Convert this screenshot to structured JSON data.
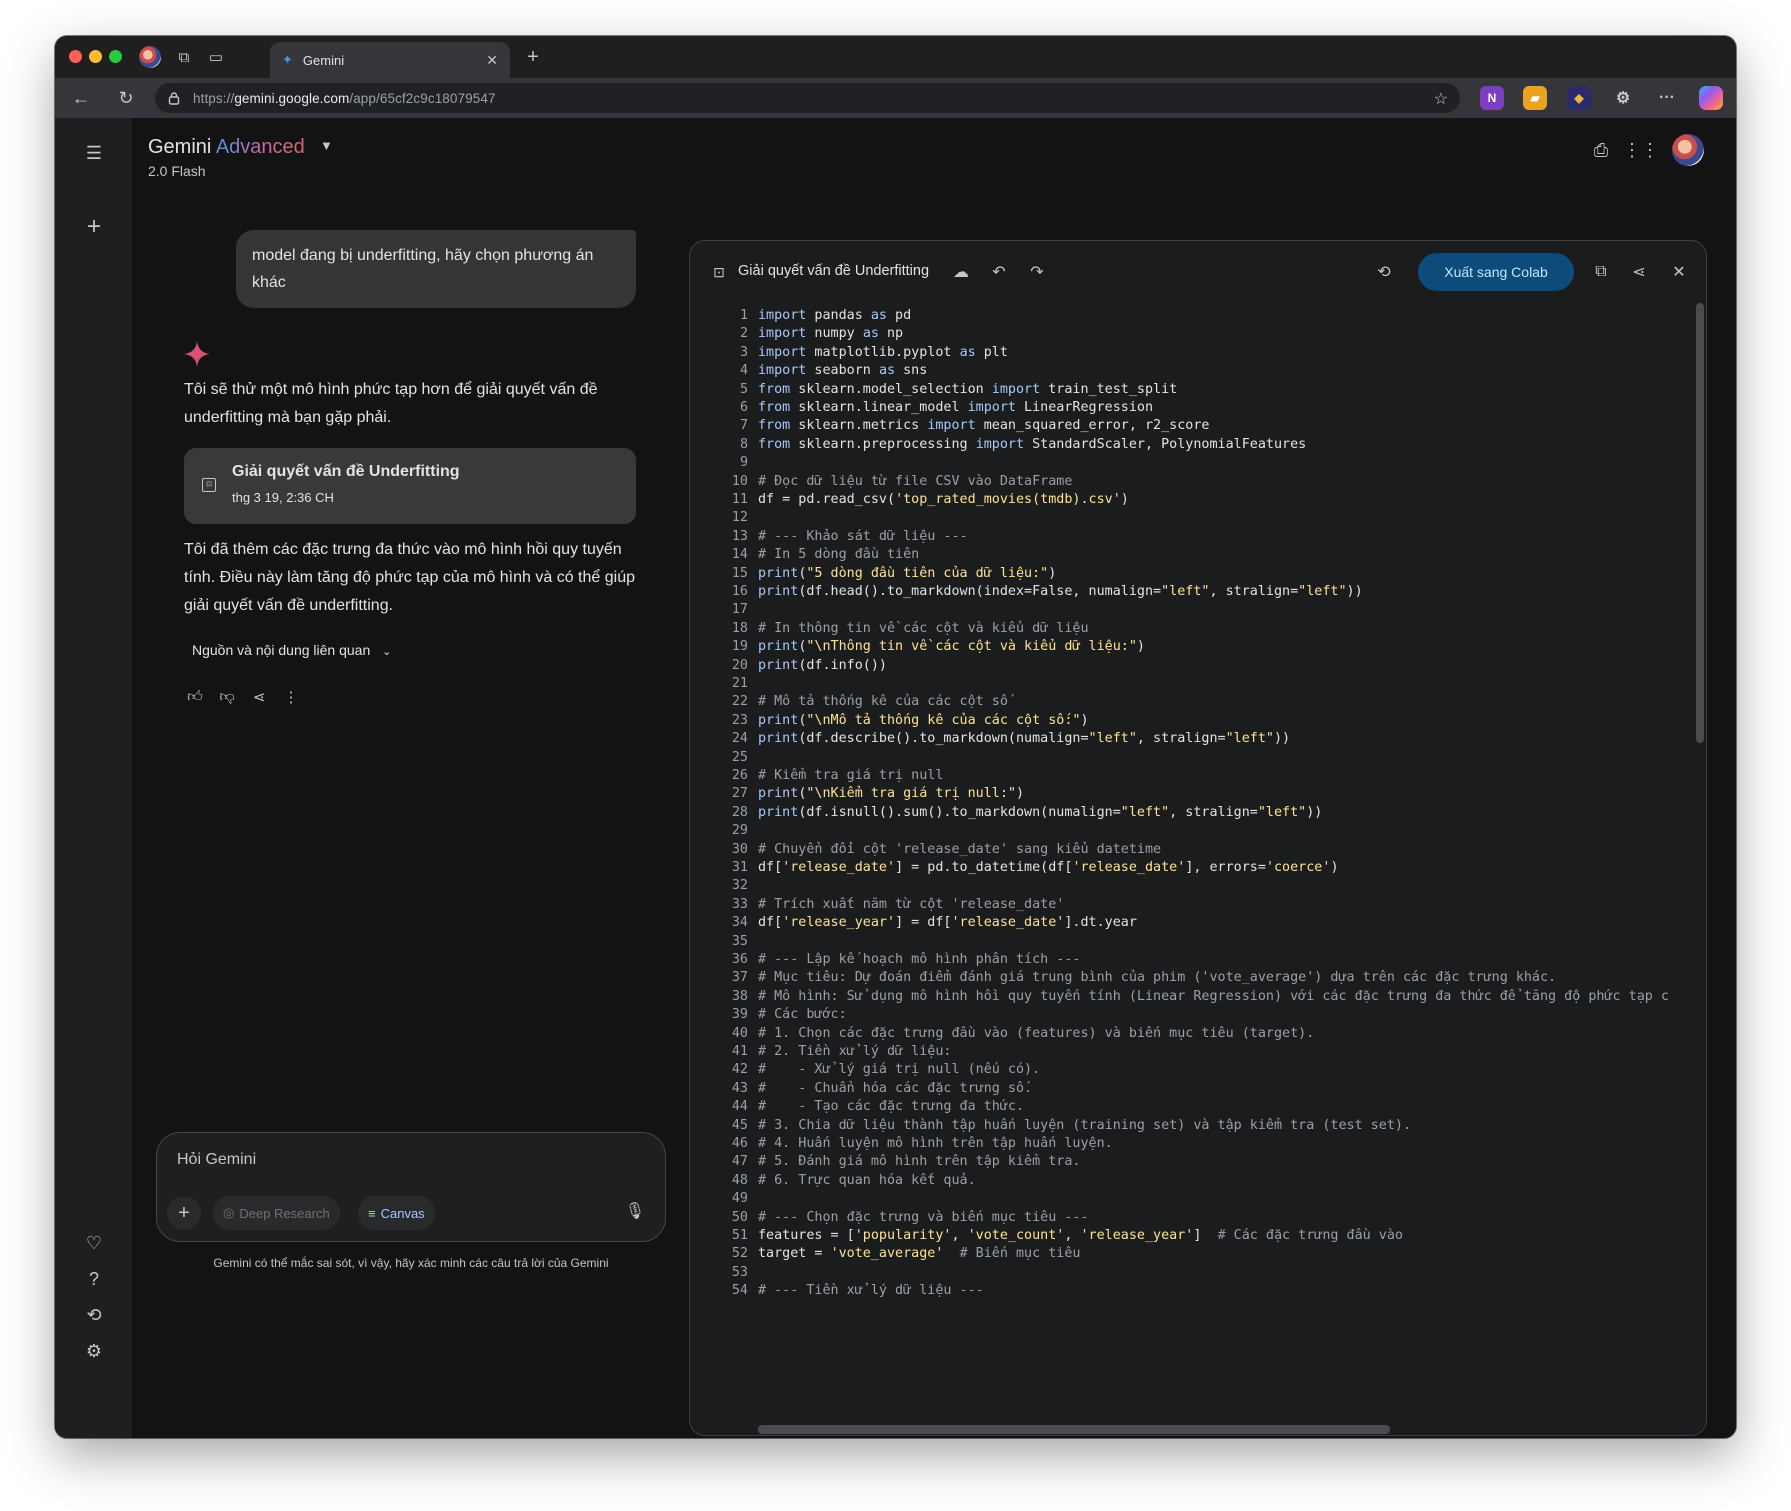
{
  "browser": {
    "tab_title": "Gemini",
    "url_prefix": "https://",
    "url_host": "gemini.google.com",
    "url_path": "/app/65cf2c9c18079547"
  },
  "header": {
    "title_main": "Gemini",
    "title_accent": "Advanced",
    "model": "2.0 Flash"
  },
  "chat": {
    "user_message": "model đang bị underfitting, hãy chọn phương án khác",
    "response_intro": "Tôi sẽ thử một mô hình phức tạp hơn để giải quyết vấn đề underfitting mà bạn gặp phải.",
    "doc_card": {
      "title": "Giải quyết vấn đề Underfitting",
      "date": "thg 3 19, 2:36 CH"
    },
    "response_outro": "Tôi đã thêm các đặc trưng đa thức vào mô hình hồi quy tuyến tính. Điều này làm tăng độ phức tạp của mô hình và có thể giúp giải quyết vấn đề underfitting.",
    "sources_label": "Nguồn và nội dung liên quan"
  },
  "input": {
    "placeholder": "Hỏi Gemini",
    "chip_deep_research": "Deep Research",
    "chip_canvas": "Canvas",
    "disclaimer": "Gemini có thể mắc sai sót, vì vậy, hãy xác minh các câu trả lời của Gemini"
  },
  "canvas": {
    "title": "Giải quyết vấn đề Underfitting",
    "export_button": "Xuất sang Colab",
    "code_lines": [
      "import pandas as pd",
      "import numpy as np",
      "import matplotlib.pyplot as plt",
      "import seaborn as sns",
      "from sklearn.model_selection import train_test_split",
      "from sklearn.linear_model import LinearRegression",
      "from sklearn.metrics import mean_squared_error, r2_score",
      "from sklearn.preprocessing import StandardScaler, PolynomialFeatures",
      "",
      "# Đọc dữ liệu từ file CSV vào DataFrame",
      "df = pd.read_csv('top_rated_movies(tmdb).csv')",
      "",
      "# --- Khảo sát dữ liệu ---",
      "# In 5 dòng đầu tiên",
      "print(\"5 dòng đầu tiên của dữ liệu:\")",
      "print(df.head().to_markdown(index=False, numalign=\"left\", stralign=\"left\"))",
      "",
      "# In thông tin về các cột và kiểu dữ liệu",
      "print(\"\\nThông tin về các cột và kiểu dữ liệu:\")",
      "print(df.info())",
      "",
      "# Mô tả thống kê của các cột số",
      "print(\"\\nMô tả thống kê của các cột số:\")",
      "print(df.describe().to_markdown(numalign=\"left\", stralign=\"left\"))",
      "",
      "# Kiểm tra giá trị null",
      "print(\"\\nKiểm tra giá trị null:\")",
      "print(df.isnull().sum().to_markdown(numalign=\"left\", stralign=\"left\"))",
      "",
      "# Chuyển đổi cột 'release_date' sang kiểu datetime",
      "df['release_date'] = pd.to_datetime(df['release_date'], errors='coerce')",
      "",
      "# Trích xuất năm từ cột 'release_date'",
      "df['release_year'] = df['release_date'].dt.year",
      "",
      "# --- Lập kế hoạch mô hình phân tích ---",
      "# Mục tiêu: Dự đoán điểm đánh giá trung bình của phim ('vote_average') dựa trên các đặc trưng khác.",
      "# Mô hình: Sử dụng mô hình hồi quy tuyến tính (Linear Regression) với các đặc trưng đa thức để tăng độ phức tạp c",
      "# Các bước:",
      "# 1. Chọn các đặc trưng đầu vào (features) và biến mục tiêu (target).",
      "# 2. Tiền xử lý dữ liệu:",
      "#    - Xử lý giá trị null (nếu có).",
      "#    - Chuẩn hóa các đặc trưng số.",
      "#    - Tạo các đặc trưng đa thức.",
      "# 3. Chia dữ liệu thành tập huấn luyện (training set) và tập kiểm tra (test set).",
      "# 4. Huấn luyện mô hình trên tập huấn luyện.",
      "# 5. Đánh giá mô hình trên tập kiểm tra.",
      "# 6. Trực quan hóa kết quả.",
      "",
      "# --- Chọn đặc trưng và biến mục tiêu ---",
      "features = ['popularity', 'vote_count', 'release_year']  # Các đặc trưng đầu vào",
      "target = 'vote_average'  # Biến mục tiêu",
      "",
      "# --- Tiền xử lý dữ liệu ---"
    ]
  },
  "colors": {
    "keyword": "#a8c7fa",
    "string": "#fde293",
    "comment": "#9aa0a6",
    "accent_button": "#0c4b7a"
  }
}
